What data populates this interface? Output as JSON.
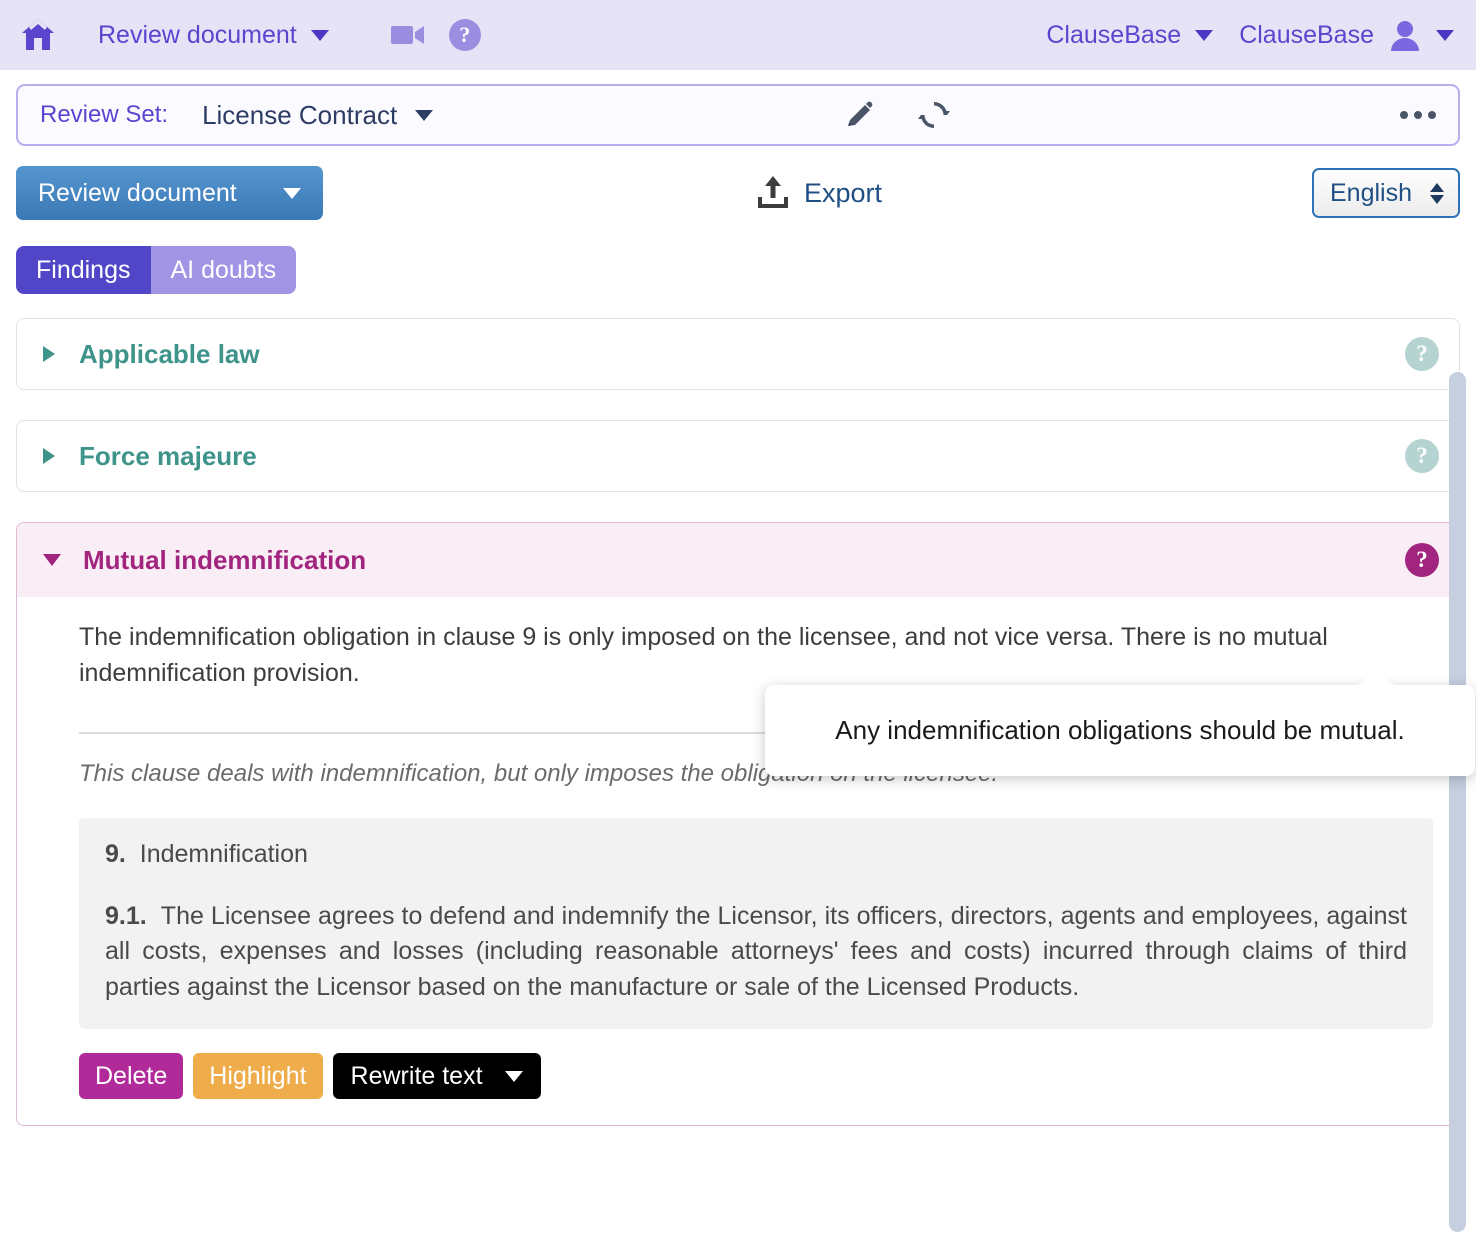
{
  "topbar": {
    "home_icon": "home-icon",
    "app_menu_label": "Review document",
    "video_icon": "video-camera-icon",
    "help_icon": "help-circle-icon",
    "org_label": "ClauseBase",
    "user_label": "ClauseBase",
    "avatar_icon": "user-avatar-icon"
  },
  "reviewset": {
    "label": "Review Set:",
    "value": "License Contract",
    "edit_icon": "pencil-icon",
    "refresh_icon": "refresh-icon",
    "more_icon": "ellipsis-icon"
  },
  "toolbar": {
    "mode_button_label": "Review document",
    "export_label": "Export",
    "export_icon": "upload-icon",
    "language_value": "English"
  },
  "tabs": [
    {
      "label": "Findings",
      "active": true
    },
    {
      "label": "AI doubts",
      "active": false
    }
  ],
  "findings": [
    {
      "title": "Applicable law",
      "expanded": false,
      "help_icon": "help-circle-icon"
    },
    {
      "title": "Force majeure",
      "expanded": false,
      "help_icon": "help-circle-icon"
    },
    {
      "title": "Mutual indemnification",
      "expanded": true,
      "help_icon": "help-circle-icon",
      "description": "The indemnification obligation in clause 9 is only imposed on the licensee, and not vice versa. There is no mutual indemnification provision.",
      "clause_note": "This clause deals with indemnification, but only imposes the obligation on the licensee.",
      "clause_number": "9.",
      "clause_heading": "Indemnification",
      "clause_sub_number": "9.1.",
      "clause_body": "The Licensee agrees to defend and indemnify the Licensor, its officers, directors, agents and employees, against all costs, expenses and losses (including reasonable attorneys' fees and costs) incurred through claims of third parties against the Licensor based on the manufacture or sale of the Licensed Products.",
      "actions": {
        "delete_label": "Delete",
        "highlight_label": "Highlight",
        "rewrite_label": "Rewrite text"
      }
    }
  ],
  "tooltip": {
    "text": "Any indemnification obligations should be mutual."
  },
  "colors": {
    "topbar_bg": "#e7e3f6",
    "purple_text": "#5b45cf",
    "tab_active": "#5145c8",
    "tab_inactive": "#a294e4",
    "finding_teal": "#3e938b",
    "finding_magenta": "#a1257e",
    "blue_button": "#3a79b5",
    "delete_magenta": "#b02a9a",
    "highlight_orange": "#eeac4a",
    "rewrite_black": "#000000"
  }
}
